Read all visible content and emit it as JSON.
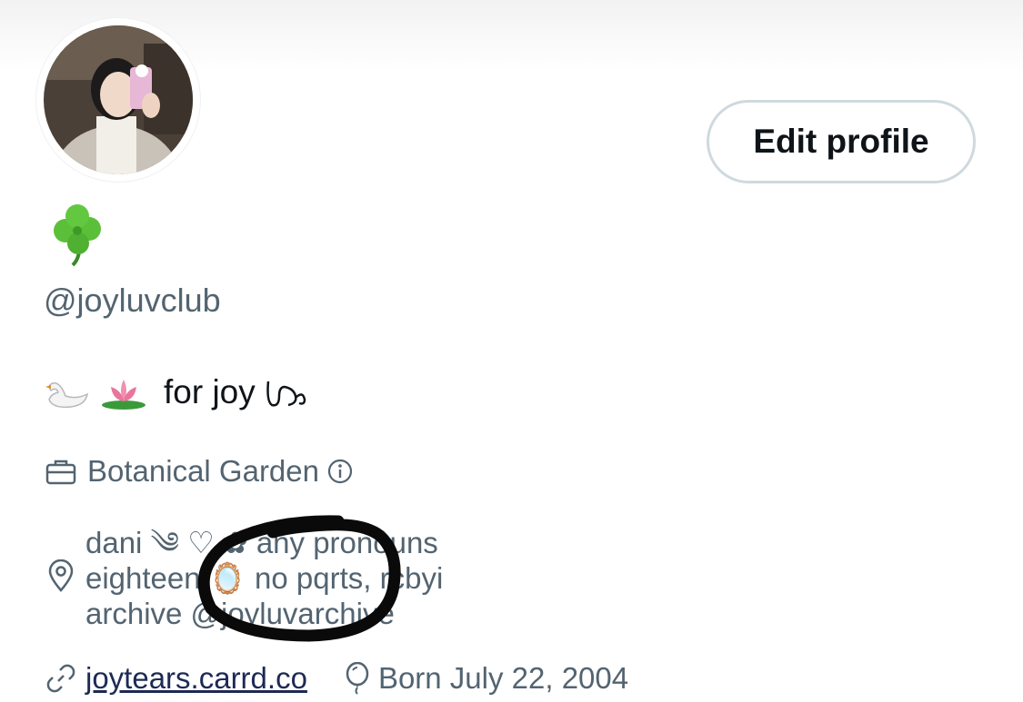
{
  "profile": {
    "display_name_icon": "shamrock-emoji",
    "handle": "@joyluvclub",
    "bio_text": "for joy",
    "work": "Botanical Garden",
    "location_lines": [
      "dani ༄ ♡ ✿ any pronouns",
      "eighteen 🪞 no pqrts, rcbyi",
      "archive @joyluvarchive"
    ],
    "website": "joytears.carrd.co",
    "birthday": "Born July 22, 2004"
  },
  "actions": {
    "edit_profile_label": "Edit profile"
  }
}
